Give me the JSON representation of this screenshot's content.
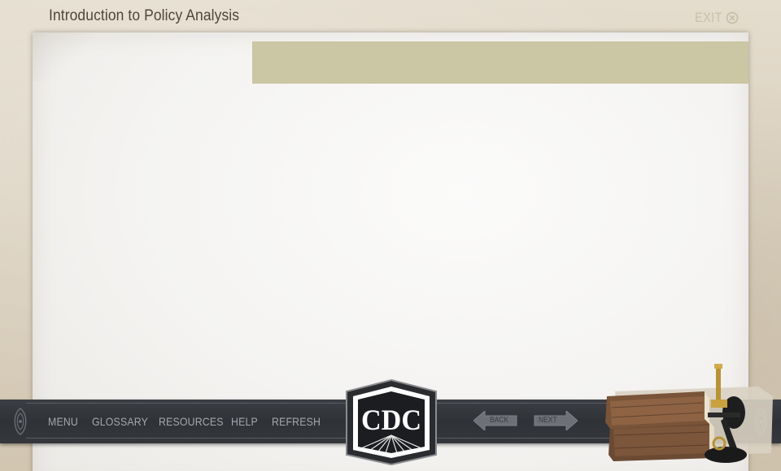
{
  "header": {
    "course_title": "Introduction to Policy Analysis",
    "exit_label": "EXIT"
  },
  "nav": {
    "items": [
      {
        "label": "MENU"
      },
      {
        "label": "GLOSSARY"
      },
      {
        "label": "RESOURCES"
      },
      {
        "label": "HELP"
      },
      {
        "label": "REFRESH"
      }
    ],
    "back_label": "BACK",
    "next_label": "NEXT"
  },
  "logo": {
    "text": "CDC"
  },
  "icons": {
    "exit": "close-circle-icon",
    "back": "arrow-left-icon",
    "next": "arrow-right-icon",
    "decor": "books-microscope-illustration"
  },
  "colors": {
    "header_bar": "#cbc6a3",
    "nav_bar": "#33363b",
    "nav_text": "#a5a8ac",
    "title_text": "#4f4639",
    "exit_text": "#c9bfa9"
  }
}
